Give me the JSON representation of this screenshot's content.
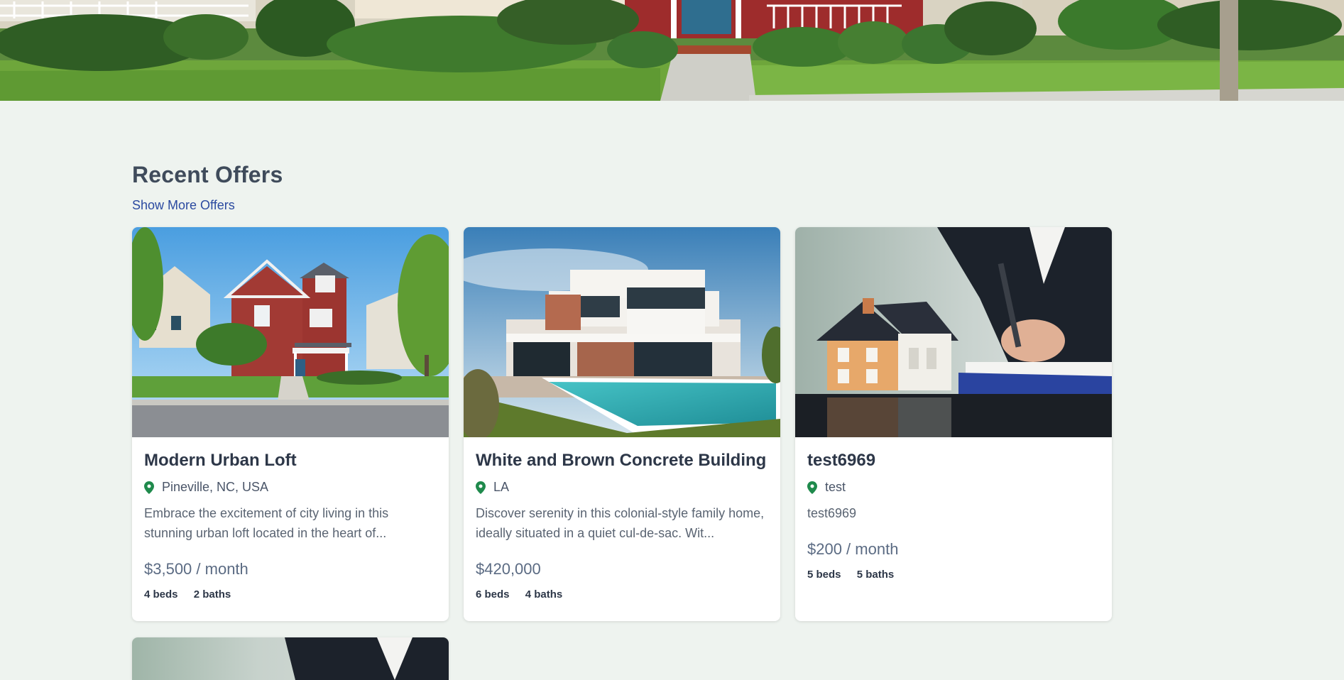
{
  "section": {
    "title": "Recent Offers",
    "more_link": "Show More Offers"
  },
  "listings": [
    {
      "title": "Modern Urban Loft",
      "location": "Pineville, NC, USA",
      "description": "Embrace the excitement of city living in this stunning urban loft located in the heart of...",
      "price": "$3,500 / month",
      "beds": "4 beds",
      "baths": "2 baths"
    },
    {
      "title": "White and Brown Concrete Building",
      "location": "LA",
      "description": "Discover serenity in this colonial-style family home, ideally situated in a quiet cul-de-sac. Wit...",
      "price": "$420,000",
      "beds": "6 beds",
      "baths": "4 baths"
    },
    {
      "title": "test6969",
      "location": "test",
      "description": "test6969",
      "price": "$200 / month",
      "beds": "5 beds",
      "baths": "5 baths"
    }
  ],
  "colors": {
    "page_bg": "#eef3ef",
    "link": "#2b4aa0",
    "pin": "#1f8a4c",
    "price": "#5b6b83"
  },
  "icons": {
    "location": "map-pin-icon"
  }
}
